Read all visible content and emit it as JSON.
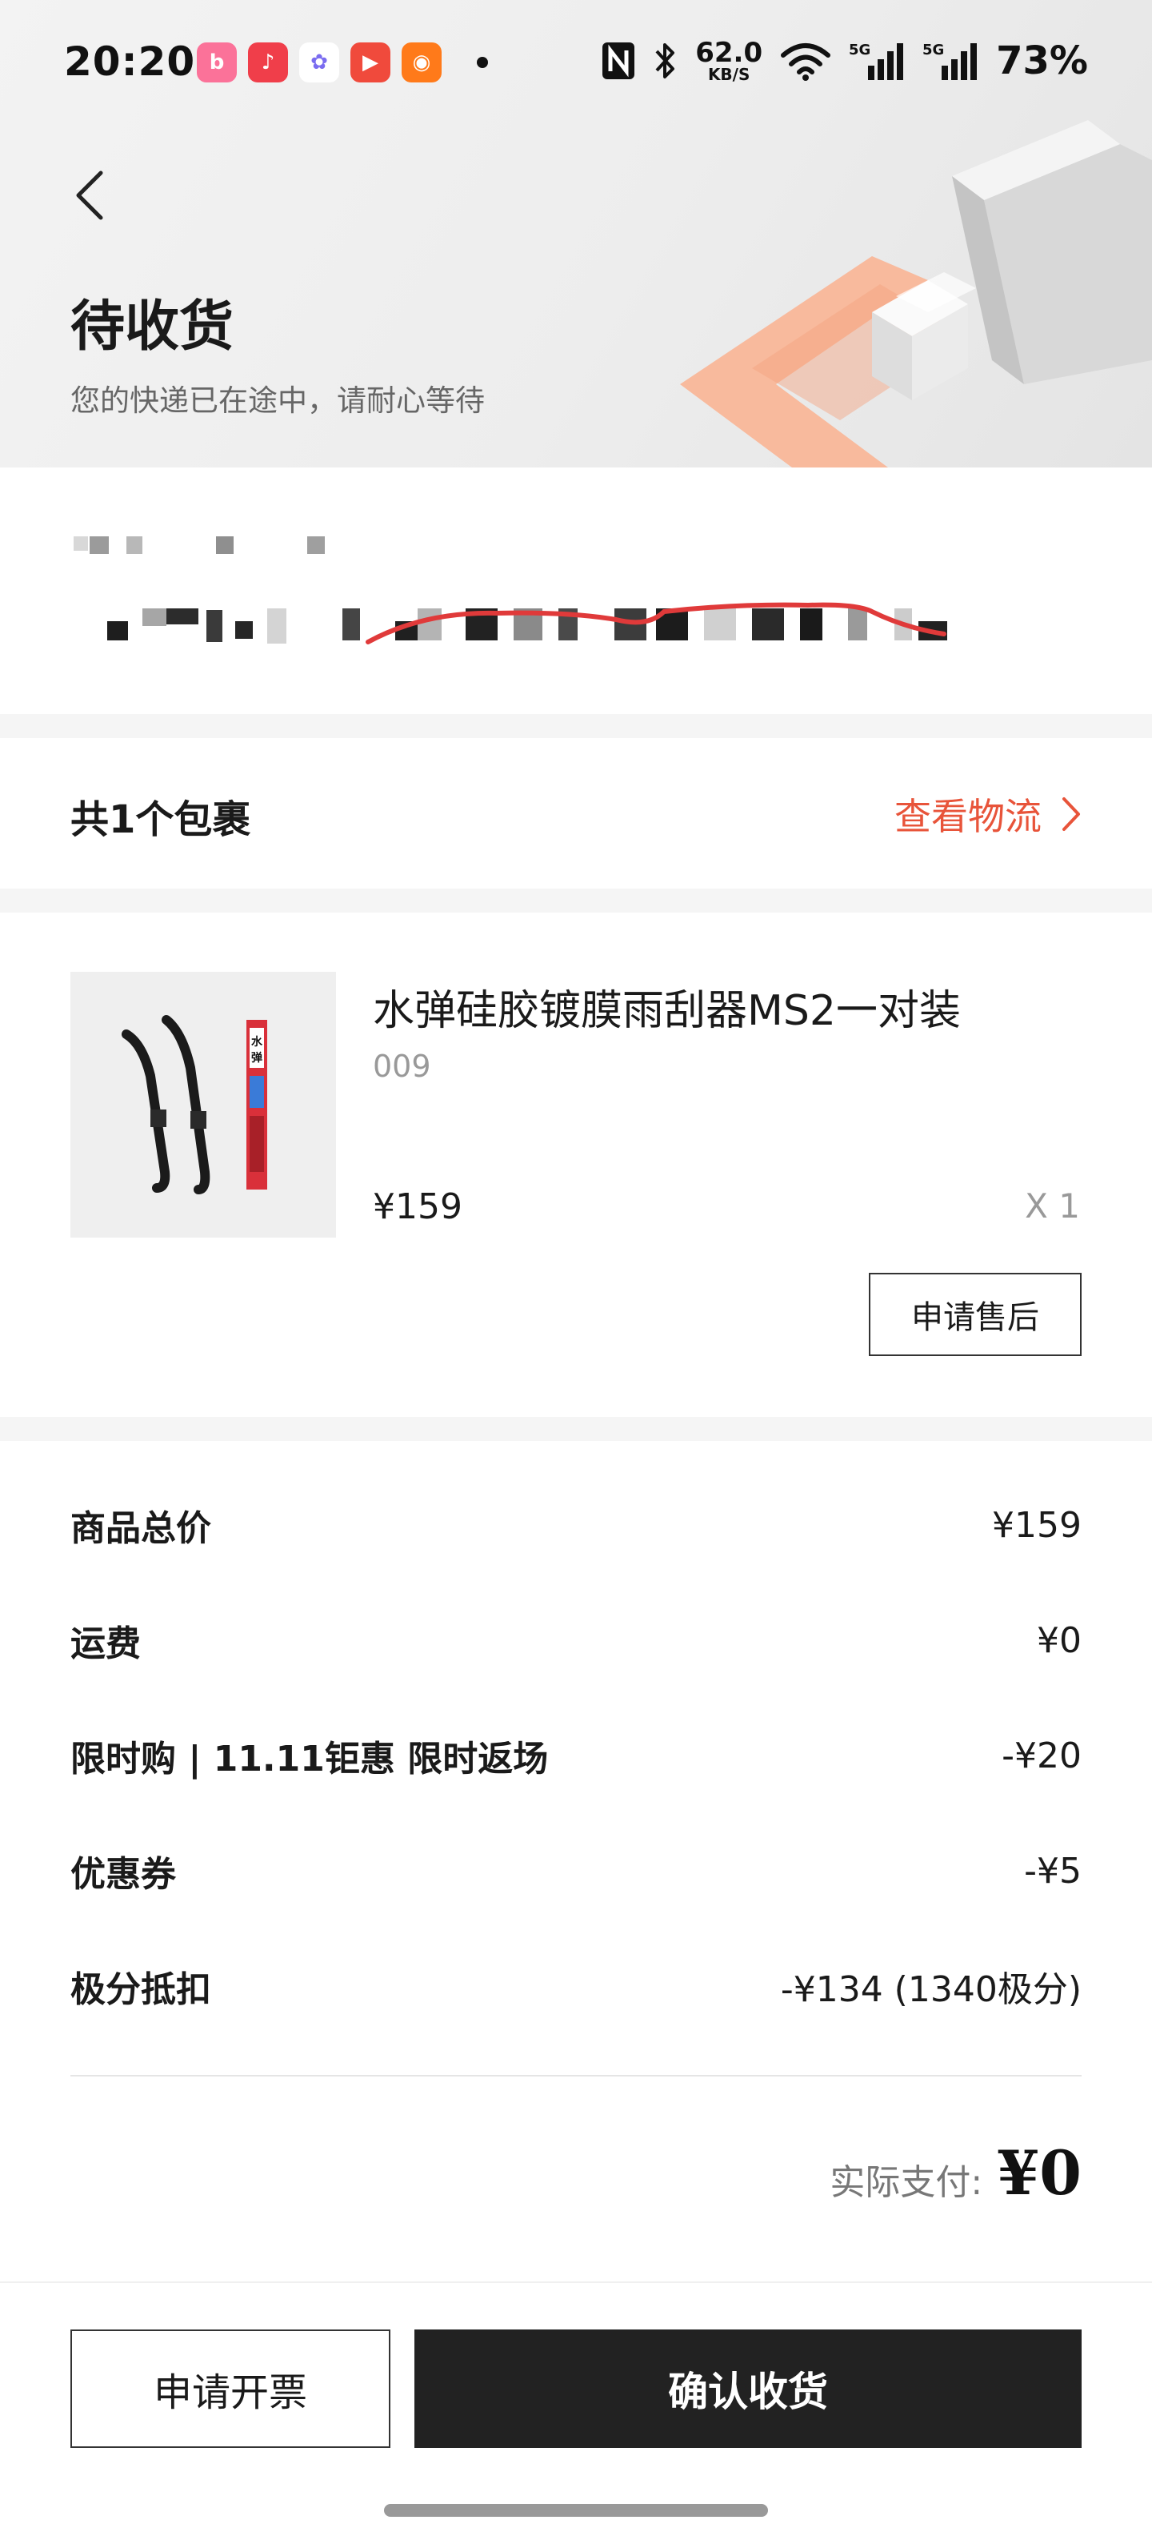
{
  "status_bar": {
    "time": "20:20",
    "apps": [
      {
        "name": "bilibili",
        "glyph": "b",
        "color": "#fb7299"
      },
      {
        "name": "music",
        "glyph": "♪",
        "color": "#f03e4a"
      },
      {
        "name": "photos",
        "glyph": "✿",
        "color": "#ffffff"
      },
      {
        "name": "video",
        "glyph": "▶",
        "color": "#f04a3c"
      },
      {
        "name": "kuaishou",
        "glyph": "◉",
        "color": "#ff7a1a"
      }
    ],
    "net_speed_value": "62.0",
    "net_speed_unit": "KB/S",
    "signal_1_label": "5G",
    "signal_2_label": "5G",
    "battery": "73%"
  },
  "header": {
    "title": "待收货",
    "subtitle": "您的快递已在途中，请耐心等待"
  },
  "package": {
    "title": "共1个包裹",
    "tracking_link": "查看物流"
  },
  "product": {
    "name": "水弹硅胶镀膜雨刮器MS2一对装",
    "spec": "009",
    "price": "¥159",
    "quantity": "X 1",
    "package_label": "水弹",
    "aftersale_button": "申请售后"
  },
  "price_summary": {
    "rows": [
      {
        "label": "商品总价",
        "value": "¥159"
      },
      {
        "label": "运费",
        "value": "¥0"
      },
      {
        "label": "限时购 | 11.11钜惠 限时返场",
        "value": "-¥20"
      },
      {
        "label": "优惠券",
        "value": "-¥5"
      },
      {
        "label": "极分抵扣",
        "value": "-¥134 (1340极分)"
      }
    ],
    "actual_pay_label": "实际支付:",
    "actual_pay_value": "¥0"
  },
  "bottom_bar": {
    "invoice_button": "申请开票",
    "confirm_button": "确认收货"
  },
  "colors": {
    "accent": "#e8543a",
    "primary_button": "#222222",
    "header_bg": "#efefef"
  }
}
